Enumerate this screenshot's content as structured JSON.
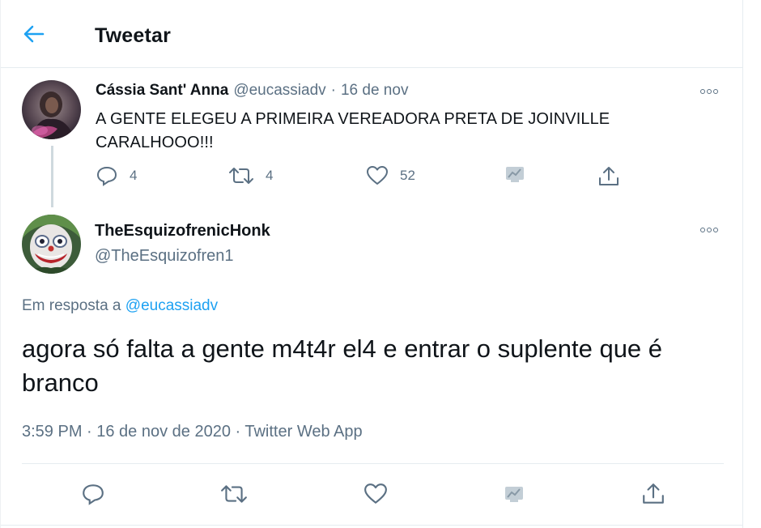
{
  "header": {
    "title": "Tweetar",
    "back_icon": "arrow-left-icon"
  },
  "colors": {
    "accent": "#1da1f2",
    "secondary_text": "#5b7083",
    "primary_text": "#0f1419",
    "divider": "#e6ecf0"
  },
  "parent_tweet": {
    "name": "Cássia Sant' Anna",
    "handle": "@eucassiadv",
    "separator": "·",
    "date": "16 de nov",
    "text": "A GENTE ELEGEU A PRIMEIRA VEREADORA PRETA DE JOINVILLE CARALHOOO!!!",
    "replies": "4",
    "retweets": "4",
    "likes": "52"
  },
  "reply_tweet": {
    "name": "TheEsquizofrenicHonk",
    "handle": "@TheEsquizofren1",
    "reply_prefix": "Em resposta a",
    "reply_mention": "@eucassiadv",
    "text": "agora só falta a gente m4t4r el4 e entrar o suplente que é branco",
    "timestamp": "3:59 PM · 16 de nov de 2020 · Twitter Web App"
  }
}
